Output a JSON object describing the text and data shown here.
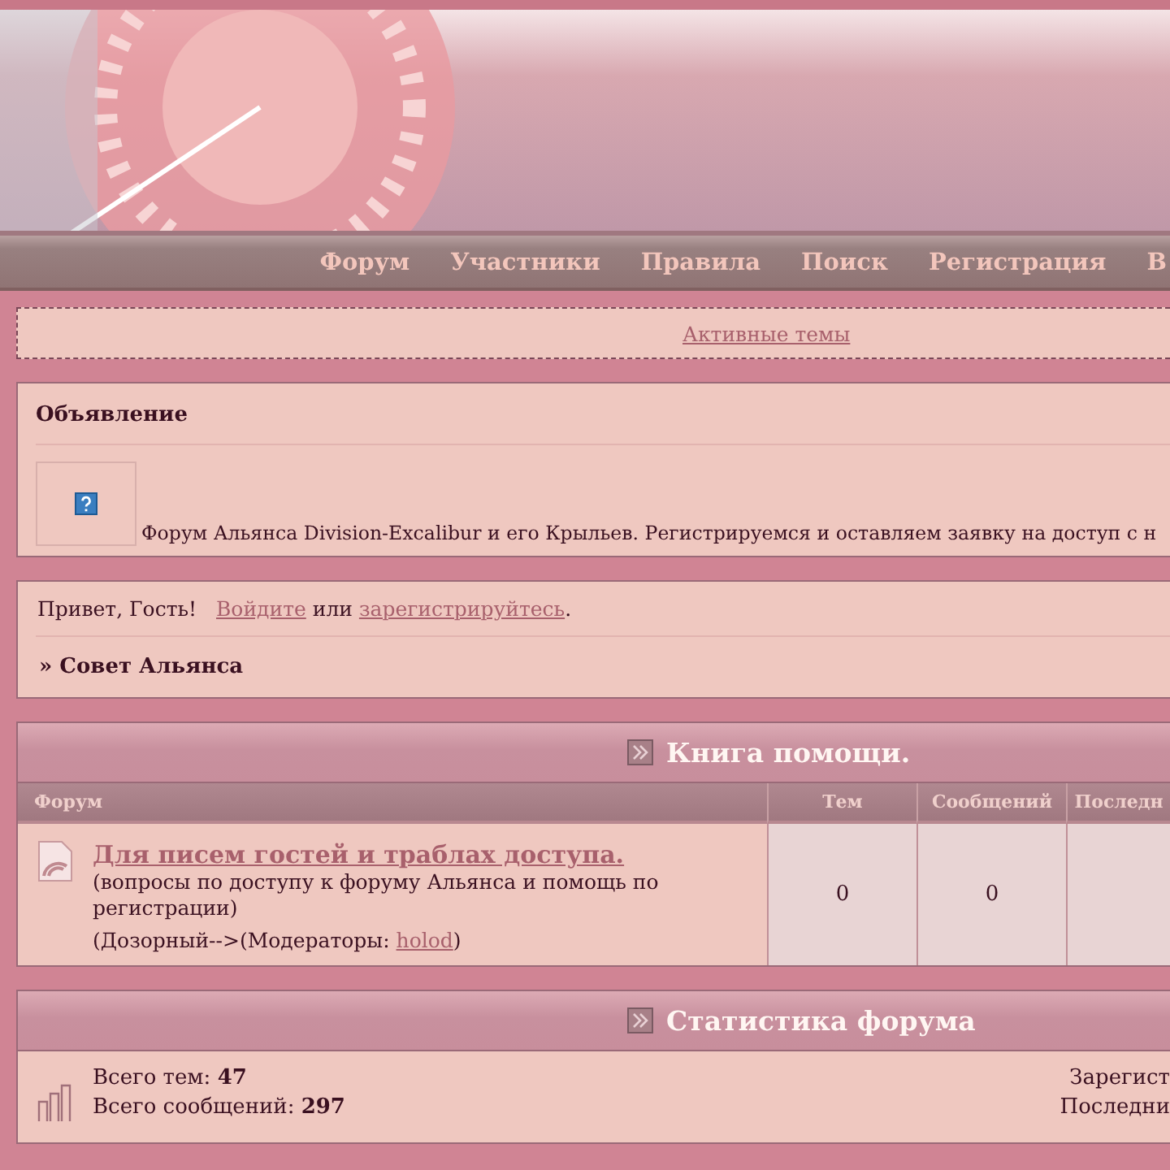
{
  "nav": [
    {
      "label": "Форум"
    },
    {
      "label": "Участники"
    },
    {
      "label": "Правила"
    },
    {
      "label": "Поиск"
    },
    {
      "label": "Регистрация"
    },
    {
      "label": "В"
    }
  ],
  "active_topics_link": "Активные темы",
  "announcement": {
    "title": "Объявление",
    "text": "Форум Альянса Division-Excalibur и его Крыльев. Регистрируемся и оставляем заявку на доступ с н"
  },
  "welcome": {
    "greeting": "Привет, Гость!",
    "login_link": "Войдите",
    "or": "или",
    "register_link": "зарегистрируйтесь",
    "end": "."
  },
  "breadcrumb": "» Совет Альянса",
  "category": {
    "title": "Книга помощи.",
    "columns": [
      "Форум",
      "Тем",
      "Сообщений",
      "Последн"
    ],
    "forums": [
      {
        "title": "Для писем гостей и траблах доступа.",
        "description": "(вопросы по доступу к форуму Альянса и помощь по регистрации)",
        "moderators_prefix": "(Дозорный-->(Модераторы: ",
        "moderator": "holod",
        "moderators_suffix": ")",
        "topics": "0",
        "posts": "0"
      }
    ]
  },
  "stats": {
    "title": "Статистика форума",
    "left": [
      {
        "label": "Всего тем:",
        "value": "47"
      },
      {
        "label": "Всего сообщений:",
        "value": "297"
      }
    ],
    "right": [
      "Зарегист",
      "Последни"
    ]
  }
}
